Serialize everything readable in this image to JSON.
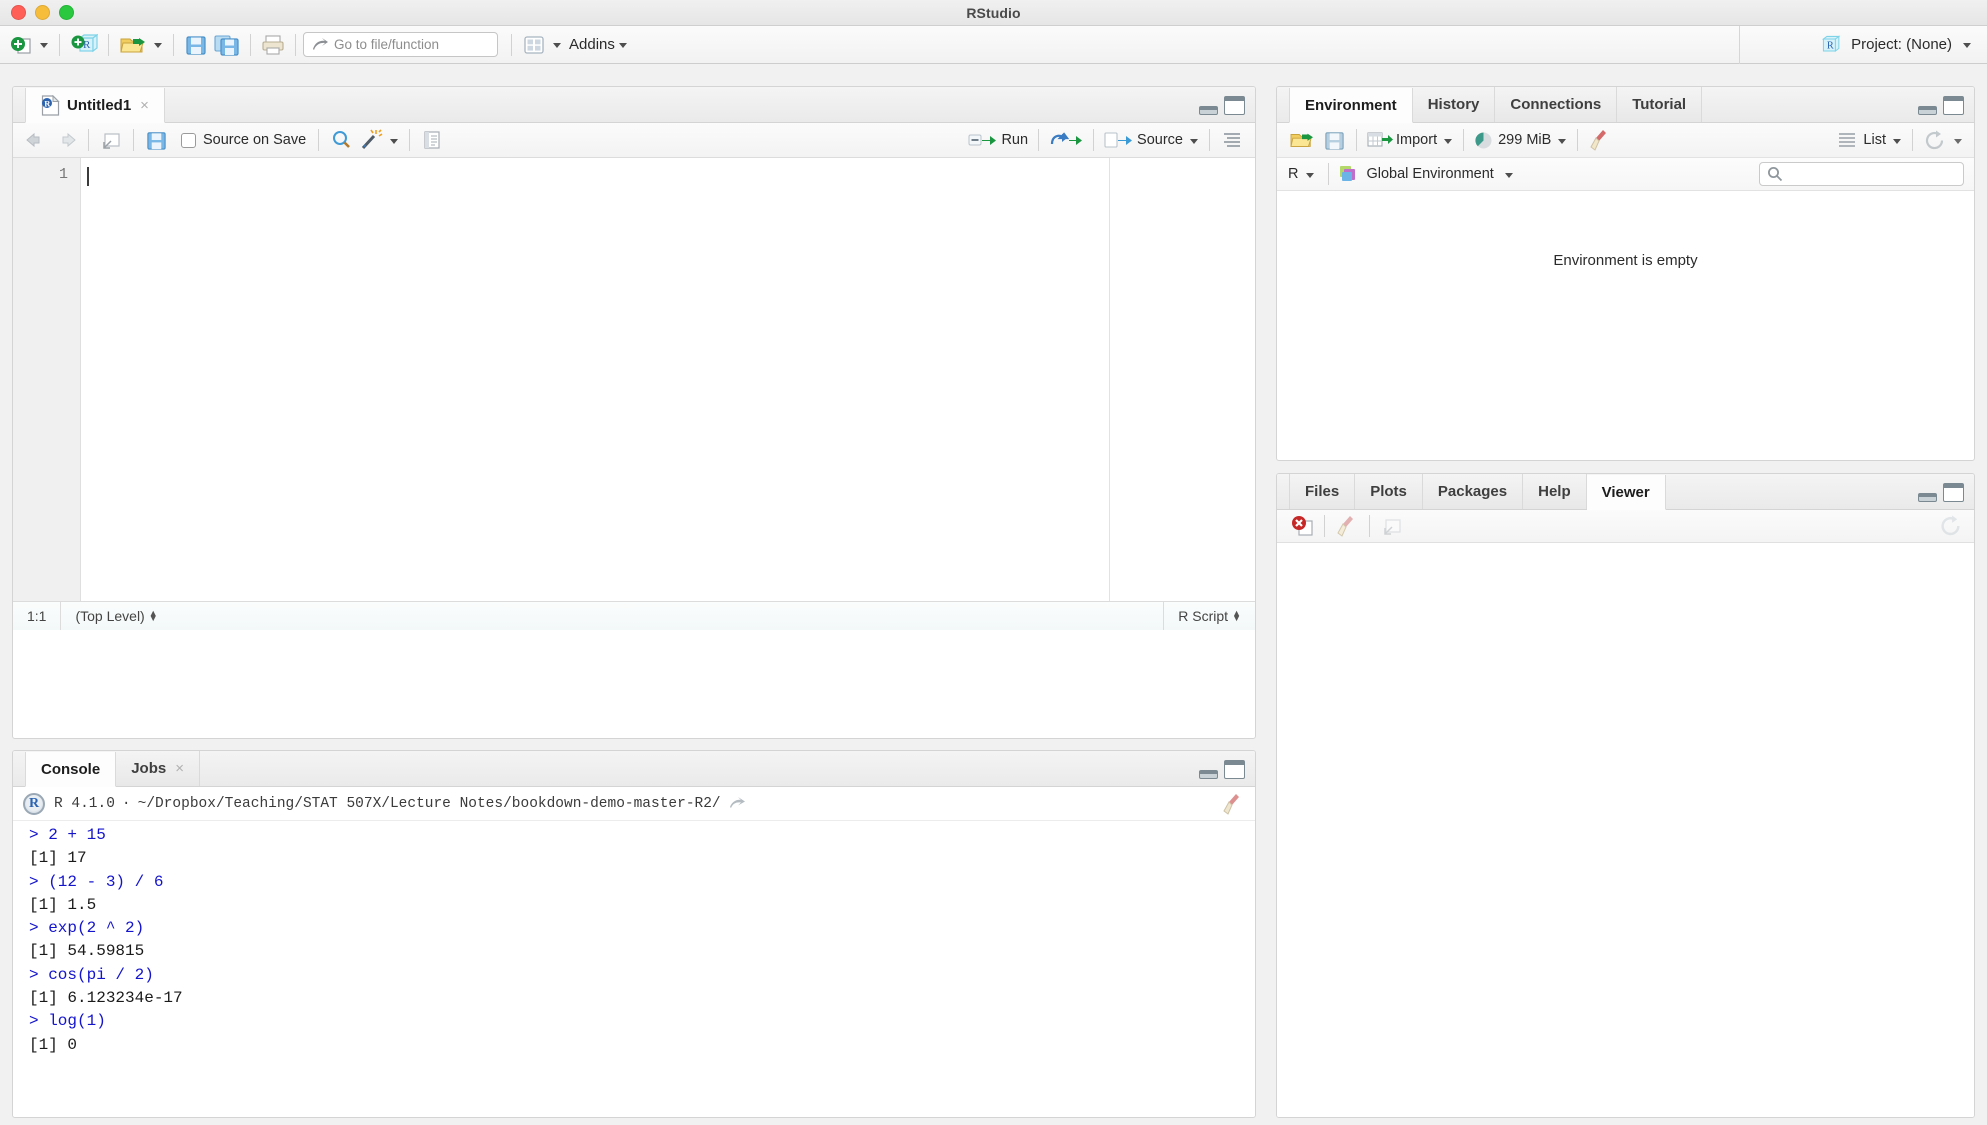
{
  "window": {
    "title": "RStudio",
    "traffic_lights": [
      "close-red",
      "minimize-yellow",
      "maximize-green"
    ]
  },
  "main_toolbar": {
    "new_file_icon": "new-file-plus-icon",
    "new_project_icon": "new-project-r-cube-icon",
    "open_file_icon": "open-folder-icon",
    "save_icon": "save-disk-icon",
    "save_all_icon": "save-all-disks-icon",
    "print_icon": "printer-icon",
    "goto_placeholder": "Go to file/function",
    "goto_value": "",
    "goto_icon": "goto-arrow-icon",
    "workspace_panes_icon": "pane-layout-icon",
    "addins_label": "Addins",
    "project_label": "Project: (None)",
    "project_icon": "r-cube-icon"
  },
  "source_pane": {
    "tab_label": "Untitled1",
    "tab_icon": "r-script-file-icon",
    "tab_close": "×",
    "toolbar": {
      "back_icon": "arrow-left-icon",
      "forward_icon": "arrow-right-icon",
      "popout_icon": "show-in-new-window-icon",
      "save_icon": "save-disk-icon",
      "source_on_save_label": "Source on Save",
      "source_on_save_checked": false,
      "find_icon": "magnifier-icon",
      "wand_icon": "code-tools-wand-icon",
      "compile_report_icon": "compile-notebook-icon",
      "run_label": "Run",
      "run_icon": "run-arrow-icon",
      "rerun_icon": "re-run-previous-icon",
      "source_label": "Source",
      "source_icon": "source-arrow-icon",
      "outline_icon": "document-outline-icon"
    },
    "line_numbers": [
      "1"
    ],
    "code_lines": [
      ""
    ],
    "status": {
      "cursor_position": "1:1",
      "scope": "(Top Level)",
      "file_type": "R Script"
    }
  },
  "console_pane": {
    "tabs": [
      {
        "label": "Console",
        "active": true,
        "closable": false
      },
      {
        "label": "Jobs",
        "active": false,
        "closable": true
      }
    ],
    "header": {
      "r_version": "R 4.1.0",
      "separator": "·",
      "working_directory": "~/Dropbox/Teaching/STAT 507X/Lecture Notes/bookdown-demo-master-R2/",
      "popout_icon": "view-in-pane-icon",
      "clear_icon": "broom-clear-console-icon",
      "r_logo": "R"
    },
    "lines": [
      {
        "type": "input",
        "text": "> 2 + 15"
      },
      {
        "type": "output",
        "text": "[1] 17"
      },
      {
        "type": "input",
        "text": "> (12 - 3) / 6"
      },
      {
        "type": "output",
        "text": "[1] 1.5"
      },
      {
        "type": "input",
        "text": "> exp(2 ^ 2)"
      },
      {
        "type": "output",
        "text": "[1] 54.59815"
      },
      {
        "type": "input",
        "text": "> cos(pi / 2)"
      },
      {
        "type": "output",
        "text": "[1] 6.123234e-17"
      },
      {
        "type": "input",
        "text": "> log(1)"
      },
      {
        "type": "output",
        "text": "[1] 0"
      }
    ]
  },
  "env_pane": {
    "tabs": [
      {
        "label": "Environment",
        "active": true
      },
      {
        "label": "History",
        "active": false
      },
      {
        "label": "Connections",
        "active": false
      },
      {
        "label": "Tutorial",
        "active": false
      }
    ],
    "toolbar": {
      "load_icon": "open-folder-load-workspace-icon",
      "save_icon": "save-workspace-icon",
      "import_label": "Import",
      "import_icon": "import-dataset-icon",
      "memory_label": "299 MiB",
      "memory_icon": "memory-pie-icon",
      "clear_icon": "broom-clear-objects-icon",
      "view_mode_label": "List",
      "view_mode_icon": "list-view-icon",
      "refresh_icon": "refresh-icon"
    },
    "toolbar2": {
      "language_label": "R",
      "environment_label": "Global Environment",
      "environment_icon": "global-environment-icon",
      "search_placeholder": "",
      "search_value": "",
      "search_icon": "search-icon"
    },
    "empty_message": "Environment is empty"
  },
  "viewer_pane": {
    "tabs": [
      {
        "label": "Files",
        "active": false
      },
      {
        "label": "Plots",
        "active": false
      },
      {
        "label": "Packages",
        "active": false
      },
      {
        "label": "Help",
        "active": false
      },
      {
        "label": "Viewer",
        "active": true
      }
    ],
    "toolbar": {
      "stop_icon": "stop-remove-icon",
      "clear_icon": "broom-clear-viewer-icon",
      "popout_icon": "show-in-new-window-icon",
      "refresh_icon": "refresh-viewer-icon"
    },
    "content": ""
  },
  "colors": {
    "console_input": "#1414cc",
    "console_output": "#1a1a1a",
    "accent_green": "#1a9641",
    "accent_blue": "#3a7cc4",
    "titlebar_bg": "#ececec",
    "pane_bg": "#ffffff",
    "toolbar_bg": "#f4f4f4"
  }
}
